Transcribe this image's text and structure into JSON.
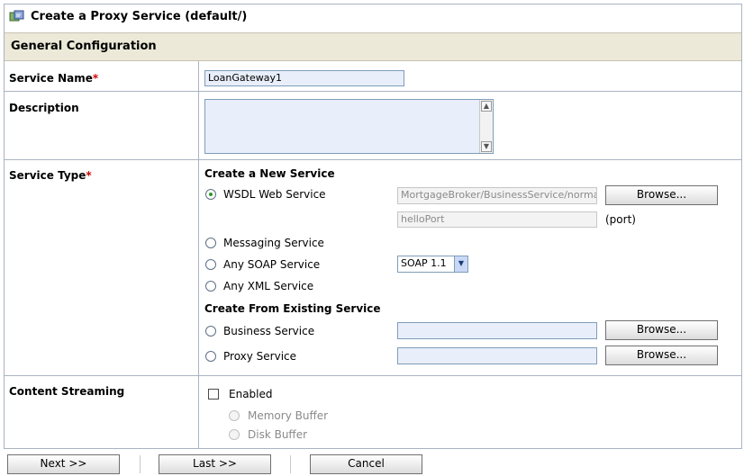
{
  "window": {
    "title": "Create a Proxy Service (default/)",
    "icon": "proxy-service-icon"
  },
  "section": {
    "title": "General Configuration"
  },
  "service_name": {
    "label": "Service Name",
    "required_mark": "*",
    "value": "LoanGateway1"
  },
  "description": {
    "label": "Description",
    "value": ""
  },
  "service_type": {
    "label": "Service Type",
    "required_mark": "*",
    "create_new_heading": "Create a New Service",
    "wsdl": {
      "label": "WSDL Web Service",
      "checked": true,
      "value": "MortgageBroker/BusinessService/normall",
      "browse_label": "Browse...",
      "port_value": "helloPort",
      "port_label": "(port)"
    },
    "messaging": {
      "label": "Messaging Service",
      "checked": false
    },
    "any_soap": {
      "label": "Any SOAP Service",
      "checked": false,
      "soap_version": "SOAP 1.1"
    },
    "any_xml": {
      "label": "Any XML Service",
      "checked": false
    },
    "existing_heading": "Create From Existing Service",
    "business": {
      "label": "Business Service",
      "checked": false,
      "value": "",
      "browse_label": "Browse..."
    },
    "proxy": {
      "label": "Proxy Service",
      "checked": false,
      "value": "",
      "browse_label": "Browse..."
    }
  },
  "content_streaming": {
    "label": "Content Streaming",
    "enabled_label": "Enabled",
    "enabled": false,
    "memory_buffer_label": "Memory Buffer",
    "disk_buffer_label": "Disk Buffer"
  },
  "footer": {
    "next_label": "Next >>",
    "last_label": "Last >>",
    "cancel_label": "Cancel"
  },
  "colors": {
    "section_bg": "#ece9d8",
    "required": "#cc0000",
    "input_bg": "#e8eefa",
    "border": "#a9b4c2",
    "radio_checked": "#2a9a2a"
  }
}
